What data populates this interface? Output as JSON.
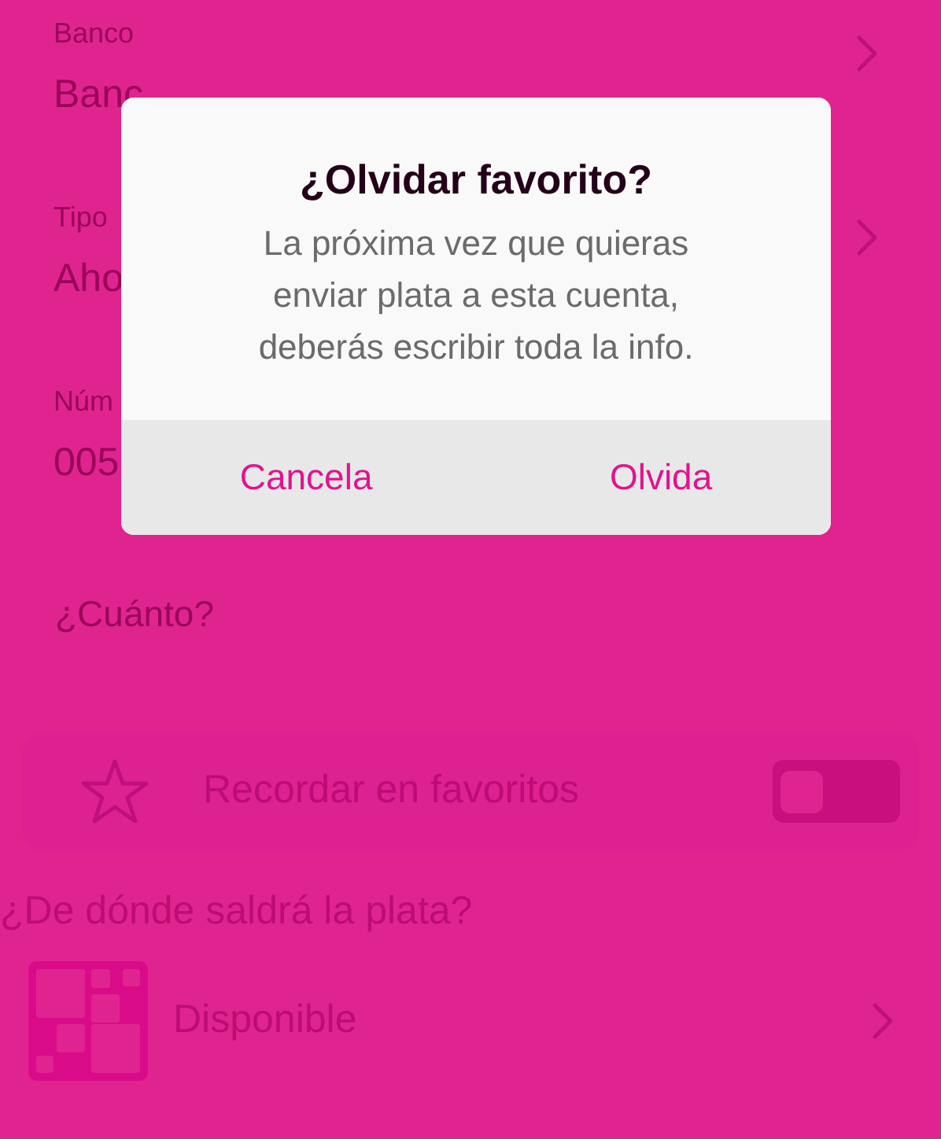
{
  "form_fields": [
    {
      "label": "Banco",
      "value": "Banc",
      "has_chevron": true
    },
    {
      "label": "Tipo",
      "value": "Aho",
      "has_chevron": true
    },
    {
      "label": "Núm",
      "value": "005",
      "has_chevron": false
    }
  ],
  "amount_label": "¿Cuánto?",
  "favorite": {
    "label": "Recordar en favoritos",
    "on": false
  },
  "source_heading": "¿De dónde saldrá la plata?",
  "source": {
    "label": "Disponible"
  },
  "dialog": {
    "title": "¿Olvidar favorito?",
    "message": "La próxima vez que quieras enviar plata a esta cuenta, deberás escribir toda la info.",
    "buttons": [
      {
        "label": "Cancela"
      },
      {
        "label": "Olvida"
      }
    ]
  }
}
